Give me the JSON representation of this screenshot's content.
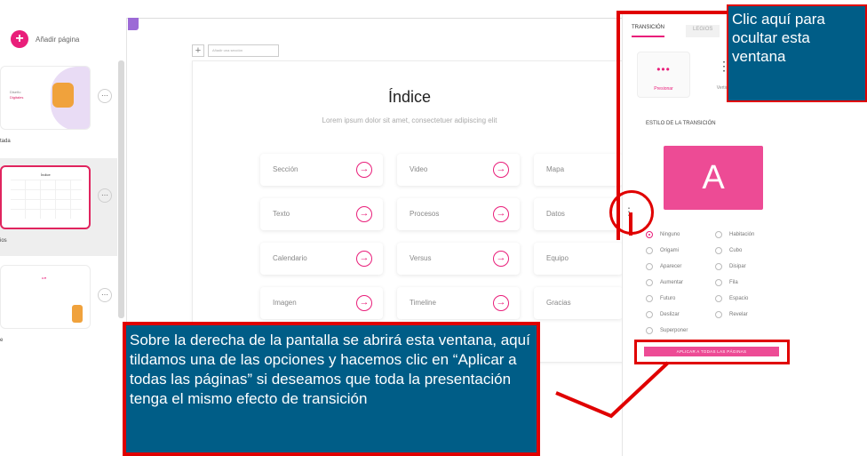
{
  "left_panel": {
    "add_page_label": "Añadir página",
    "pages": [
      {
        "caption": "tada",
        "mini_title": "Diseño",
        "mini_highlight": "Digitales"
      },
      {
        "caption": "ios",
        "mini_title": "Índice"
      },
      {
        "caption": "e",
        "mini_title": "“”"
      }
    ]
  },
  "slide": {
    "toolbar_input": "Añadir una sección",
    "title": "Índice",
    "subtitle": "Lorem ipsum dolor sit amet, consectetuer adipiscing elit",
    "cards": [
      "Sección",
      "Video",
      "Mapa",
      "Texto",
      "Procesos",
      "Datos",
      "Calendario",
      "Versus",
      "Equipo",
      "Imagen",
      "Timeline",
      "Gracias"
    ]
  },
  "right_panel": {
    "tabs": [
      "TRANSICIÓN",
      "LEGIOS"
    ],
    "anim_cards": [
      {
        "label": "Presionar",
        "icon": "dots-icon"
      },
      {
        "label": "Vertical",
        "icon": "vertical-dots-icon"
      }
    ],
    "style_label": "ESTILO DE LA TRANSICIÓN",
    "preview_letter": "A",
    "options_left": [
      "Ninguno",
      "Origami",
      "Aparecer",
      "Aumentar",
      "Futuro",
      "Deslizar",
      "Superponer"
    ],
    "options_right": [
      "Habitación",
      "Cubo",
      "Disipar",
      "Fila",
      "Espacio",
      "Revelar"
    ],
    "selected_option": "Ninguno",
    "apply_button": "APLICAR A TODAS LAS PÁGINAS"
  },
  "callouts": {
    "top": "Clic aquí para ocultar esta ventana",
    "bottom": "Sobre la derecha de la pantalla se abrirá esta ventana, aquí tildamos una de las opciones y hacemos clic en “Aplicar a todas las páginas” si deseamos que toda la presentación tenga el mismo efecto de transición"
  },
  "colors": {
    "accent": "#e91e7a",
    "callout_bg": "#005d87",
    "highlight": "#e00000"
  }
}
